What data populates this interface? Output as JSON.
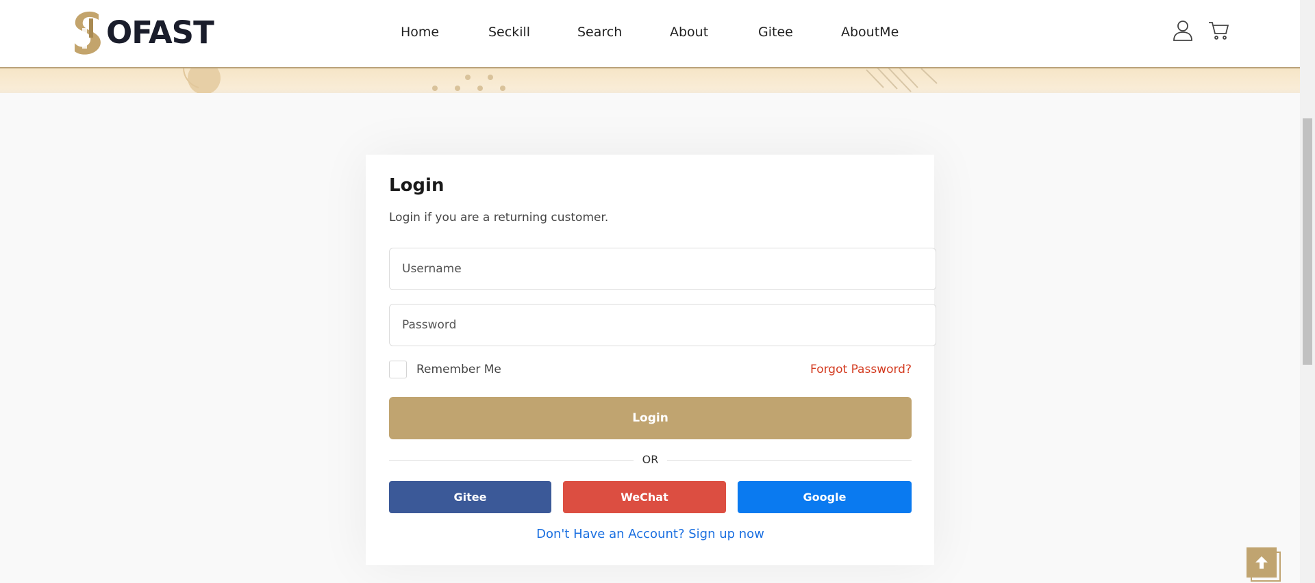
{
  "brand": {
    "name": "OFAST",
    "accent": "#c0a470",
    "dark": "#1a1d2b"
  },
  "nav": {
    "items": [
      {
        "label": "Home"
      },
      {
        "label": "Seckill"
      },
      {
        "label": "Search"
      },
      {
        "label": "About"
      },
      {
        "label": "Gitee"
      },
      {
        "label": "AboutMe"
      }
    ]
  },
  "header_icons": {
    "account": "user-icon",
    "cart": "cart-icon"
  },
  "login": {
    "title": "Login",
    "subtitle": "Login if you are a returning customer.",
    "username_placeholder": "Username",
    "username_value": "",
    "password_placeholder": "Password",
    "password_value": "",
    "remember_label": "Remember Me",
    "remember_checked": false,
    "forgot_label": "Forgot Password?",
    "submit_label": "Login",
    "divider_label": "OR",
    "social": {
      "gitee": {
        "label": "Gitee",
        "color": "#3b5998"
      },
      "wechat": {
        "label": "WeChat",
        "color": "#dc4e41"
      },
      "google": {
        "label": "Google",
        "color": "#0a7af0"
      }
    },
    "signup_label": "Don't Have an Account? Sign up now"
  },
  "back_to_top": {
    "icon": "arrow-up-icon"
  }
}
